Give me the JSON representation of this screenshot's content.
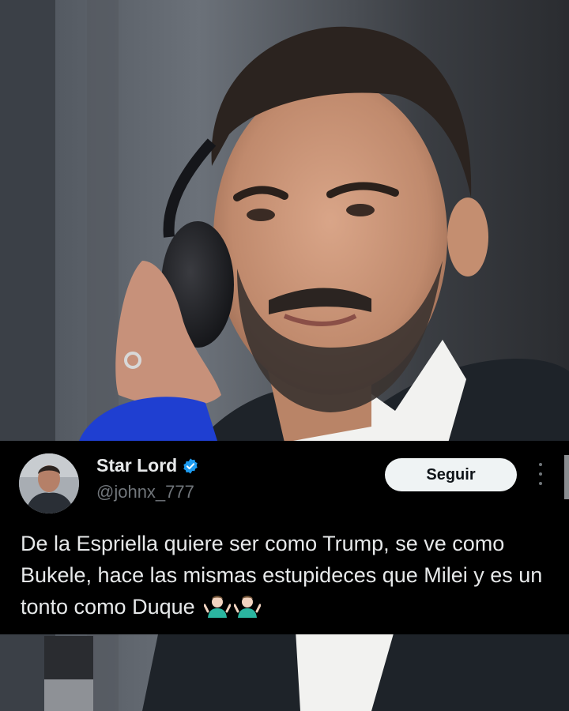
{
  "tweet": {
    "display_name": "Star Lord",
    "handle": "@johnx_777",
    "follow_label": "Seguir",
    "text": "De la Espriella quiere ser  como Trump, se ve como Bukele, hace las mismas estupideces que Milei y es un tonto como Duque"
  },
  "icons": {
    "verified": "verified-badge-icon",
    "more": "more-options-icon",
    "emoji": "person-shrugging-emoji"
  },
  "colors": {
    "verified_blue": "#1d9bf0",
    "tweet_background": "#000000",
    "follow_button_bg": "#eff3f4"
  }
}
